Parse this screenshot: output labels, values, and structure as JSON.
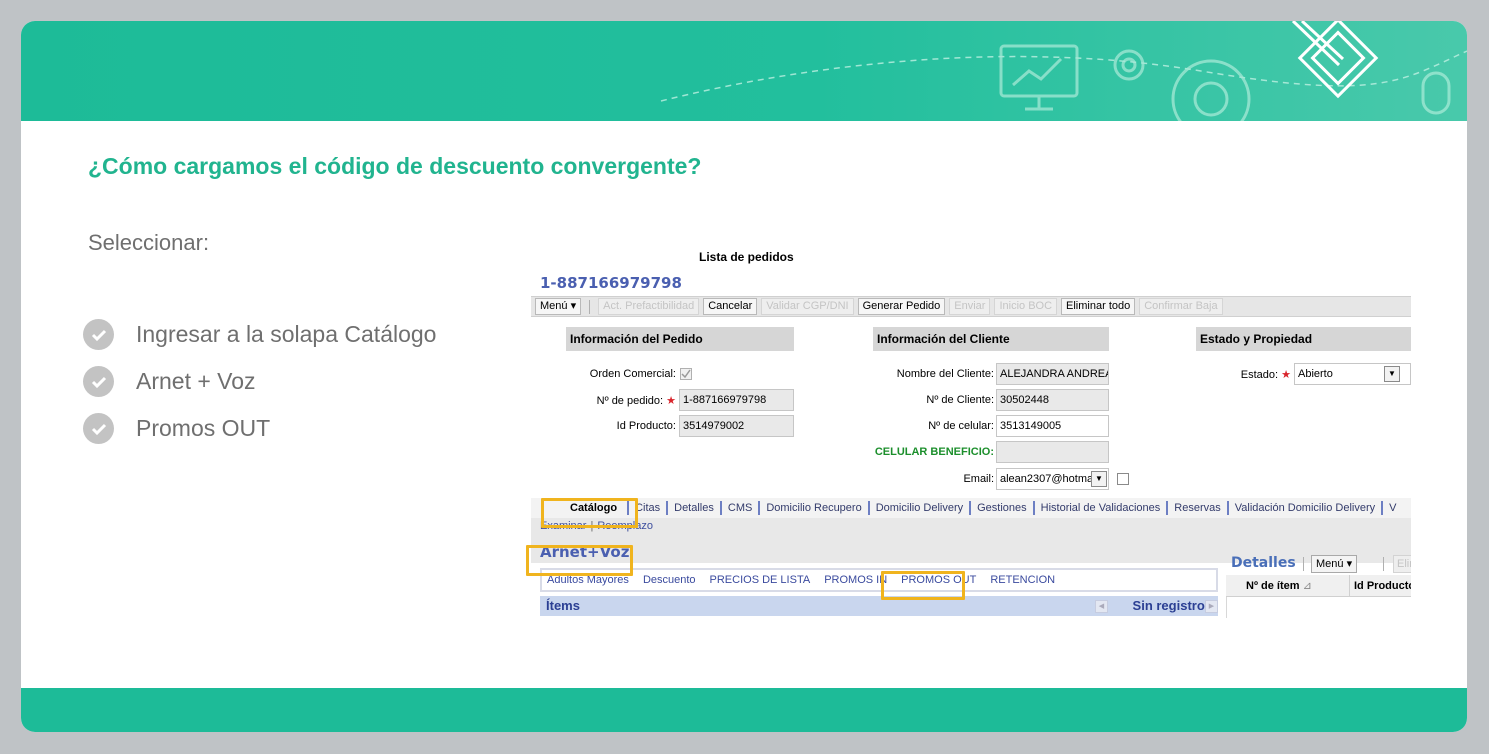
{
  "slide": {
    "title": "¿Cómo cargamos el código de descuento convergente?",
    "intro": "Seleccionar:",
    "bullets": [
      "Ingresar a la solapa Catálogo",
      "Arnet + Voz",
      "Promos OUT"
    ],
    "colors": {
      "accent": "#1dbb98",
      "title": "#21b48f",
      "highlight": "#f0b41e"
    }
  },
  "app": {
    "window_title": "Lista de pedidos",
    "order_number": "1-887166979798",
    "toolbar": {
      "menu": "Menú",
      "act_prefactibilidad": "Act. Prefactibilidad",
      "cancelar": "Cancelar",
      "validar_cgp": "Validar CGP/DNI",
      "generar_pedido": "Generar Pedido",
      "enviar": "Enviar",
      "inicio_boc": "Inicio BOC",
      "eliminar_todo": "Eliminar todo",
      "confirmar_baja": "Confirmar Baja"
    },
    "sections": {
      "pedido": "Información del Pedido",
      "cliente": "Información del Cliente",
      "estado": "Estado y Propiedad"
    },
    "pedido": {
      "orden_comercial_label": "Orden Comercial:",
      "nro_pedido_label": "Nº de pedido:",
      "nro_pedido_value": "1-887166979798",
      "id_producto_label": "Id Producto:",
      "id_producto_value": "3514979002"
    },
    "cliente": {
      "nombre_label": "Nombre del Cliente:",
      "nombre_value": "ALEJANDRA ANDREA I",
      "nro_cliente_label": "Nº de Cliente:",
      "nro_cliente_value": "30502448",
      "celular_label": "Nº de celular:",
      "celular_value": "3513149005",
      "celular_beneficio_label": "CELULAR BENEFICIO:",
      "email_label": "Email:",
      "email_value": "alean2307@hotma"
    },
    "estado": {
      "label": "Estado:",
      "value": "Abierto"
    },
    "tabs": [
      "Catálogo",
      "Citas",
      "Detalles",
      "CMS",
      "Domicilio Recupero",
      "Domicilio Delivery",
      "Gestiones",
      "Historial de Validaciones",
      "Reservas",
      "Validación Domicilio Delivery",
      "V"
    ],
    "sublinks": {
      "examinar": "Examinar",
      "separator": "|",
      "reemplazo": "Reemplazo"
    },
    "catalog_title": "Arnet+Voz",
    "catalog_items": [
      "Adultos Mayores",
      "Descuento",
      "PRECIOS DE LISTA",
      "PROMOS IN",
      "PROMOS OUT",
      "RETENCION"
    ],
    "items_header": {
      "title": "Ítems",
      "status": "Sin registros"
    },
    "detalles": {
      "title": "Detalles",
      "menu": "Menú",
      "button": "Elim",
      "col1": "Nº de ítem",
      "col2": "Id Producto"
    }
  }
}
